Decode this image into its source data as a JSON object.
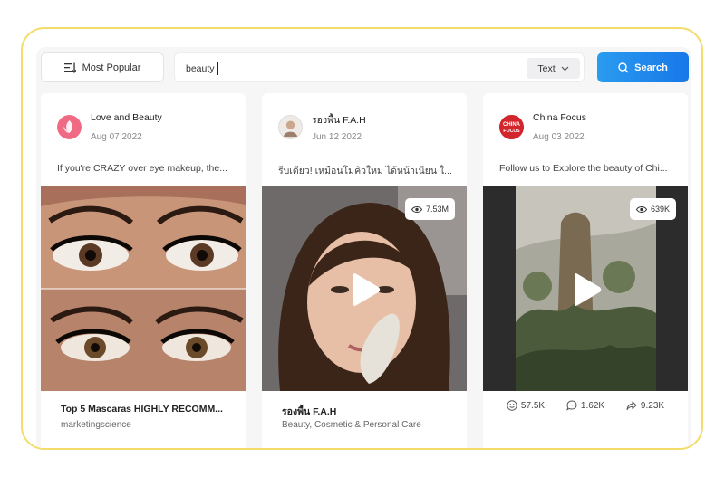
{
  "toolbar": {
    "sort_label": "Most Popular",
    "search_value": "beauty",
    "search_type": "Text",
    "search_button": "Search"
  },
  "cards": [
    {
      "author": "Love and Beauty",
      "date": "Aug 07 2022",
      "description": "If you're CRAZY over eye makeup, the...",
      "title": "Top 5 Mascaras HIGHLY RECOMM...",
      "subtitle": "marketingscience"
    },
    {
      "author": "รองพื้น F.A.H",
      "date": "Jun 12 2022",
      "description": "รีบเดียว! เหมือนโมคิวใหม่ ได้หน้าเนียน ใ...",
      "views": "7.53M",
      "title": "รองพื้น F.A.H",
      "subtitle": "Beauty, Cosmetic & Personal Care"
    },
    {
      "author": "China Focus",
      "avatar_text": "CHINA FOCUS",
      "date": "Aug 03 2022",
      "description": "Follow us to Explore the beauty of Chi...",
      "views": "639K",
      "stats": {
        "likes": "57.5K",
        "comments": "1.62K",
        "shares": "9.23K"
      }
    }
  ],
  "colors": {
    "frame_border": "#f3dc6a",
    "search_button": "#1877e8",
    "avatar_pink": "#f06a84",
    "avatar_red": "#d2262c"
  },
  "icons": [
    "sort-icon",
    "chevron-down-icon",
    "search-icon",
    "eye-icon",
    "play-icon",
    "smile-icon",
    "comment-icon",
    "share-icon"
  ]
}
